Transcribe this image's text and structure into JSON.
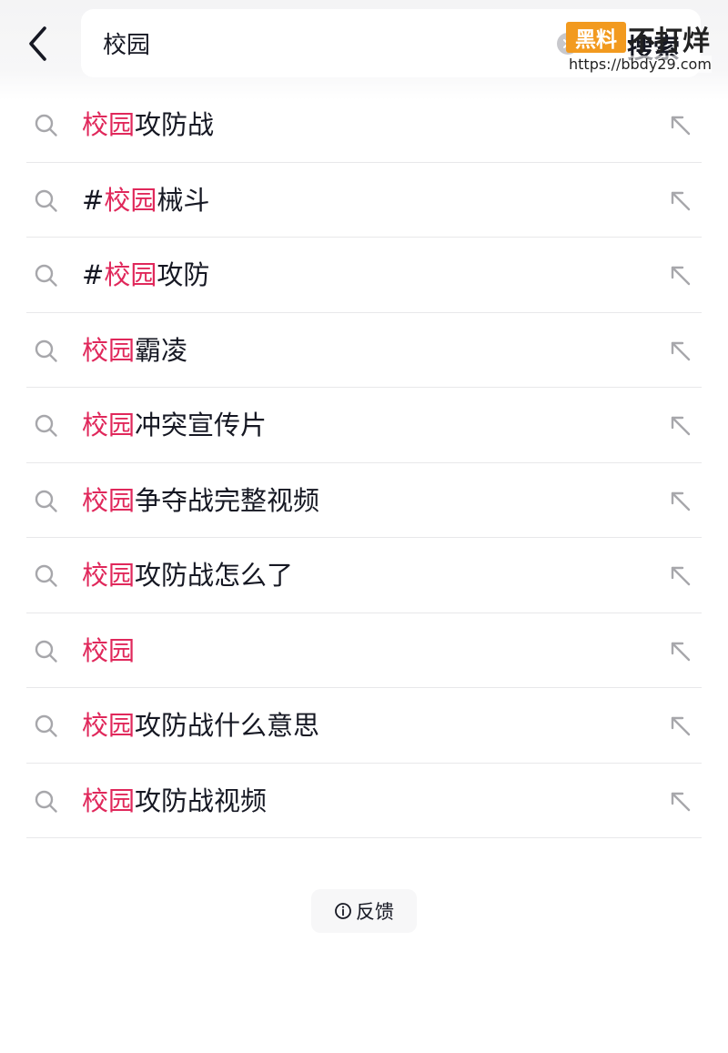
{
  "search": {
    "query": "校园",
    "submit_label": "搜索"
  },
  "suggestions": [
    {
      "prefix": "",
      "highlight": "校园",
      "rest": "攻防战"
    },
    {
      "prefix": "#",
      "highlight": "校园",
      "rest": "械斗"
    },
    {
      "prefix": "#",
      "highlight": "校园",
      "rest": "攻防"
    },
    {
      "prefix": "",
      "highlight": "校园",
      "rest": "霸凌"
    },
    {
      "prefix": "",
      "highlight": "校园",
      "rest": "冲突宣传片"
    },
    {
      "prefix": "",
      "highlight": "校园",
      "rest": "争夺战完整视频"
    },
    {
      "prefix": "",
      "highlight": "校园",
      "rest": "攻防战怎么了"
    },
    {
      "prefix": "",
      "highlight": "校园",
      "rest": ""
    },
    {
      "prefix": "",
      "highlight": "校园",
      "rest": "攻防战什么意思"
    },
    {
      "prefix": "",
      "highlight": "校园",
      "rest": "攻防战视频"
    }
  ],
  "feedback_label": "反馈",
  "watermark": {
    "badge": "黑料",
    "title": "不打烊",
    "url": "https://bbdy29.com"
  },
  "icons": {
    "back": "chevron-left-icon",
    "clear": "clear-circle-icon",
    "suggestion": "search-icon",
    "fill": "arrow-up-left-icon",
    "feedback": "info-icon"
  },
  "colors": {
    "highlight": "#e0285b",
    "text": "#161823",
    "watermark_badge": "#f29a1f"
  }
}
